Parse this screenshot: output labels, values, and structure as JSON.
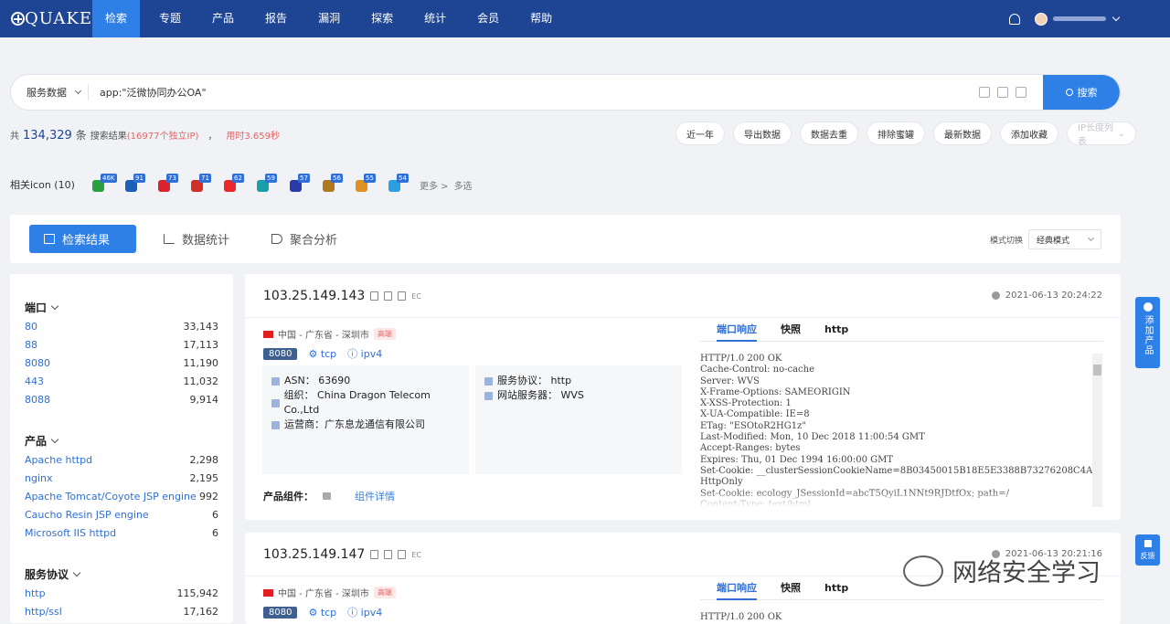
{
  "brand": "QUAKE",
  "nav": {
    "items": [
      "检索",
      "专题",
      "产品",
      "报告",
      "漏洞",
      "探索",
      "统计",
      "会员",
      "帮助"
    ],
    "active": "检索"
  },
  "search": {
    "type": "服务数据",
    "query": "app:\"泛微协同办公OA\"",
    "button": "搜索"
  },
  "stats": {
    "prefix": "共",
    "count": "134,329",
    "unit": "条",
    "label": "搜索结果",
    "ips": "(16977个独立IP)",
    "sep": "，",
    "time": "用时3.659秒"
  },
  "actions": [
    "近一年",
    "导出数据",
    "数据去重",
    "排除蜜罐",
    "最新数据",
    "添加收藏",
    "IP长度列表"
  ],
  "related_icons": {
    "label": "相关icon (10)",
    "items": [
      {
        "badge": "46K",
        "color": "#2aa040"
      },
      {
        "badge": "91",
        "color": "#1b5fb8"
      },
      {
        "badge": "73",
        "color": "#d9232d"
      },
      {
        "badge": "71",
        "color": "#d0302a"
      },
      {
        "badge": "62",
        "color": "#e8282a"
      },
      {
        "badge": "59",
        "color": "#1aa0a8"
      },
      {
        "badge": "57",
        "color": "#2a3aa8"
      },
      {
        "badge": "56",
        "color": "#b07820"
      },
      {
        "badge": "55",
        "color": "#e09020"
      },
      {
        "badge": "54",
        "color": "#2aa0e0"
      }
    ],
    "more": "更多 >",
    "multi": "多选"
  },
  "tabs": {
    "results": "检索结果",
    "stats": "数据统计",
    "agg": "聚合分析",
    "mode_label": "模式切换",
    "mode_value": "经典模式"
  },
  "filters": [
    {
      "title": "端口",
      "items": [
        [
          "80",
          "33,143"
        ],
        [
          "88",
          "17,113"
        ],
        [
          "8080",
          "11,190"
        ],
        [
          "443",
          "11,032"
        ],
        [
          "8088",
          "9,914"
        ]
      ]
    },
    {
      "title": "产品",
      "items": [
        [
          "Apache httpd",
          "2,298"
        ],
        [
          "nginx",
          "2,195"
        ],
        [
          "Apache Tomcat/Coyote JSP engine",
          "992"
        ],
        [
          "Caucho Resin JSP engine",
          "6"
        ],
        [
          "Microsoft IIS httpd",
          "6"
        ]
      ]
    },
    {
      "title": "服务协议",
      "items": [
        [
          "http",
          "115,942"
        ],
        [
          "http/ssl",
          "17,162"
        ]
      ]
    }
  ],
  "results": [
    {
      "ip": "103.25.149.143",
      "ec": "EC",
      "time": "2021-06-13 20:24:22",
      "location": "中国 - 广东省 - 深圳市",
      "tag": "高端",
      "port": "8080",
      "transport": "tcp",
      "ipver": "ipv4",
      "asn": "ASN：  63690",
      "org": "组织：  China Dragon Telecom Co.,Ltd",
      "isp": "运营商：广东息龙通信有限公司",
      "protocol": "服务协议：  http",
      "webserver": "网站服务器：  WVS",
      "component_label": "产品组件：",
      "component_link": "组件详情",
      "resp_tabs": [
        "端口响应",
        "快照",
        "http"
      ],
      "response": "HTTP/1.0 200 OK\nCache-Control: no-cache\nServer: WVS\nX-Frame-Options: SAMEORIGIN\nX-XSS-Protection: 1\nX-UA-Compatible: IE=8\nETag: \"ESOtoR2HG1z\"\nLast-Modified: Mon, 10 Dec 2018 11:00:54 GMT\nAccept-Ranges: bytes\nExpires: Thu, 01 Dec 1994 16:00:00 GMT\nSet-Cookie: __clusterSessionCookieName=8B03450015B18E5E3388B73276208C4A; path=/;\nHttpOnly\nSet-Cookie: ecology_JSessionId=abcT5QyiL1NNt9RJDtfOx; path=/\nContent-Type: text/html"
    },
    {
      "ip": "103.25.149.147",
      "ec": "EC",
      "time": "2021-06-13 20:21:16",
      "location": "中国 - 广东省 - 深圳市",
      "tag": "高端",
      "port": "8080",
      "transport": "tcp",
      "ipver": "ipv4",
      "resp_tabs": [
        "端口响应",
        "快照",
        "http"
      ],
      "response": "HTTP/1.0 200 OK"
    }
  ],
  "float": {
    "add": "添加产品",
    "feedback": "反馈"
  },
  "watermark": "网络安全学习"
}
